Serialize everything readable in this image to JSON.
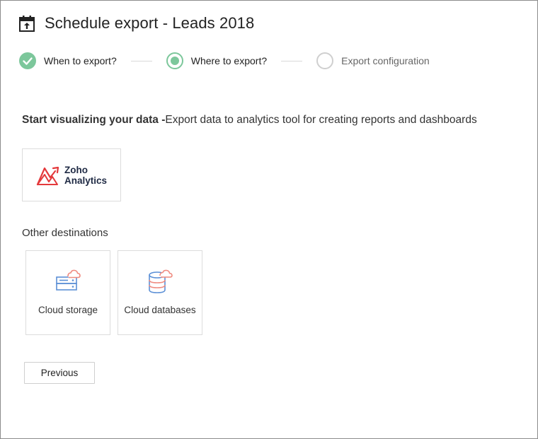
{
  "header": {
    "title": "Schedule export - Leads 2018",
    "icon": "calendar-upload-icon"
  },
  "stepper": {
    "steps": [
      {
        "label": "When to export?",
        "state": "done"
      },
      {
        "label": "Where to export?",
        "state": "active"
      },
      {
        "label": "Export configuration",
        "state": "pending"
      }
    ]
  },
  "intro": {
    "bold": "Start visualizing your data -",
    "rest": "Export data to analytics tool for creating reports and dashboards"
  },
  "analytics": {
    "brand_line1": "Zoho",
    "brand_line2": "Analytics",
    "icon": "zoho-analytics-logo"
  },
  "other": {
    "label": "Other destinations",
    "cards": [
      {
        "label": "Cloud storage",
        "icon": "cloud-storage-icon"
      },
      {
        "label": "Cloud databases",
        "icon": "cloud-database-icon"
      }
    ]
  },
  "footer": {
    "previous_label": "Previous"
  },
  "colors": {
    "step_green": "#7cc79b",
    "step_pending": "#cfcfcf",
    "icon_blue": "#5b8fd6",
    "icon_coral": "#ef8a7f",
    "zoho_red": "#e4393c"
  }
}
